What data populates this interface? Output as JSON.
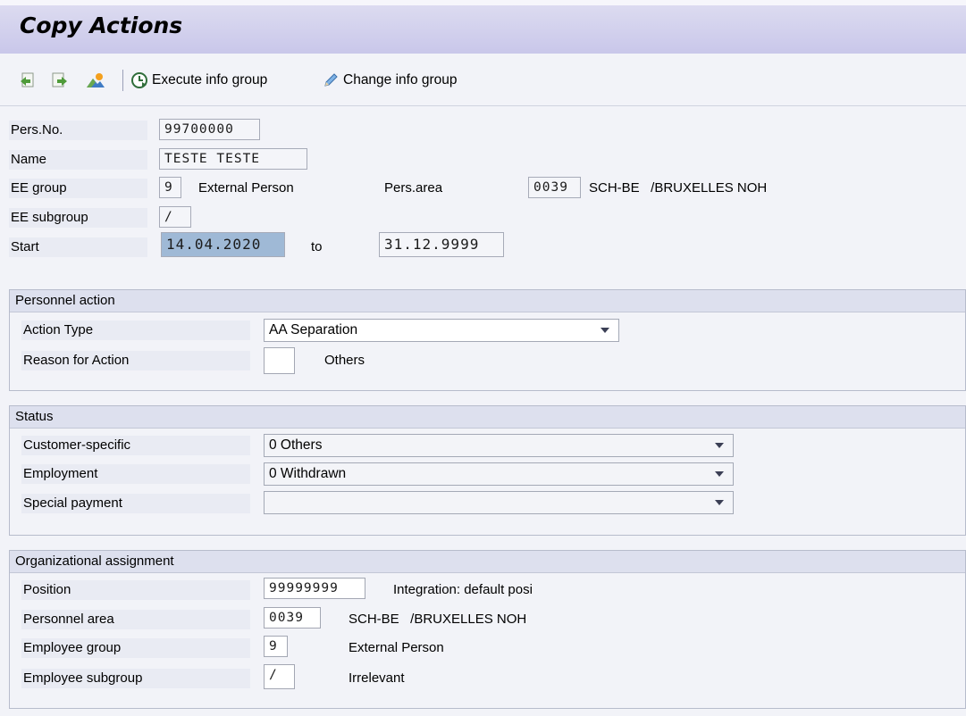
{
  "header": {
    "title": "Copy Actions"
  },
  "toolbar": {
    "icons": [
      "previous-record-icon",
      "next-record-icon",
      "mountain-image-icon"
    ],
    "execute_label": "Execute info group",
    "change_label": "Change info group"
  },
  "employee": {
    "pers_no_label": "Pers.No.",
    "pers_no": "99700000",
    "name_label": "Name",
    "name": "TESTE TESTE",
    "ee_group_label": "EE group",
    "ee_group": "9",
    "ee_group_text": "External Person",
    "pers_area_label": "Pers.area",
    "pers_area": "0039",
    "pers_area_text": "SCH-BE   /BRUXELLES NOH",
    "ee_subgroup_label": "EE subgroup",
    "ee_subgroup": "/",
    "start_label": "Start",
    "start": "14.04.2020",
    "to_label": "to",
    "end": "31.12.9999"
  },
  "personnel_action": {
    "title": "Personnel action",
    "action_type_label": "Action Type",
    "action_type": "AA Separation",
    "reason_label": "Reason for Action",
    "reason_value": "",
    "reason_text": "Others"
  },
  "status": {
    "title": "Status",
    "customer_label": "Customer-specific",
    "customer": "0 Others",
    "employment_label": "Employment",
    "employment": "0 Withdrawn",
    "special_label": "Special payment",
    "special": ""
  },
  "org_assignment": {
    "title": "Organizational assignment",
    "position_label": "Position",
    "position": "99999999",
    "position_text": "Integration: default posi",
    "area_label": "Personnel area",
    "area": "0039",
    "area_text": "SCH-BE   /BRUXELLES NOH",
    "group_label": "Employee group",
    "group": "9",
    "group_text": "External Person",
    "subgroup_label": "Employee subgroup",
    "subgroup": "/",
    "subgroup_text": "Irrelevant"
  }
}
